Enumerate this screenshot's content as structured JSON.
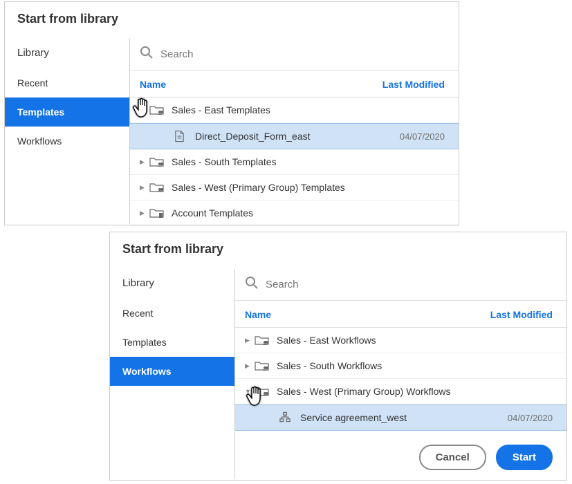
{
  "dialogA": {
    "title": "Start from library",
    "sidebar": {
      "heading": "Library",
      "items": [
        {
          "label": "Recent",
          "selected": false
        },
        {
          "label": "Templates",
          "selected": true
        },
        {
          "label": "Workflows",
          "selected": false
        }
      ]
    },
    "search": {
      "placeholder": "Search"
    },
    "columns": {
      "name": "Name",
      "modified": "Last Modified"
    },
    "rows": [
      {
        "label": "Sales - East Templates",
        "expanded": true,
        "type": "folder-group"
      },
      {
        "label": "Direct_Deposit_Form_east",
        "type": "file",
        "date": "04/07/2020",
        "child": true
      },
      {
        "label": "Sales - South Templates",
        "expanded": false,
        "type": "folder-group"
      },
      {
        "label": "Sales - West (Primary Group) Templates",
        "expanded": false,
        "type": "folder-group"
      },
      {
        "label": "Account Templates",
        "expanded": false,
        "type": "folder-account"
      }
    ]
  },
  "dialogB": {
    "title": "Start from library",
    "sidebar": {
      "heading": "Library",
      "items": [
        {
          "label": "Recent",
          "selected": false
        },
        {
          "label": "Templates",
          "selected": false
        },
        {
          "label": "Workflows",
          "selected": true
        }
      ]
    },
    "search": {
      "placeholder": "Search"
    },
    "columns": {
      "name": "Name",
      "modified": "Last Modified"
    },
    "rows": [
      {
        "label": "Sales - East Workflows",
        "expanded": false,
        "type": "folder-group"
      },
      {
        "label": "Sales - South Workflows",
        "expanded": false,
        "type": "folder-group"
      },
      {
        "label": "Sales - West (Primary Group) Workflows",
        "expanded": true,
        "type": "folder-group"
      },
      {
        "label": "Service agreement_west",
        "type": "workflow",
        "date": "04/07/2020",
        "child": true
      }
    ],
    "buttons": {
      "cancel": "Cancel",
      "start": "Start"
    }
  }
}
